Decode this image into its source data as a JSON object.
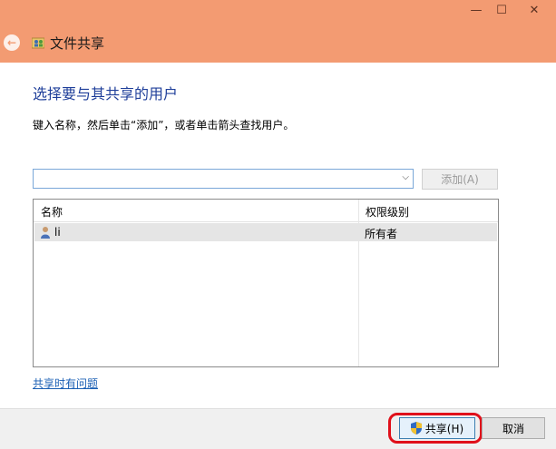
{
  "window": {
    "title": "文件共享",
    "minimize_glyph": "—",
    "maximize_glyph": "☐",
    "close_glyph": "✕"
  },
  "content": {
    "heading": "选择要与其共享的用户",
    "instruction": "键入名称，然后单击“添加”，或者单击箭头查找用户。",
    "combo_value": "",
    "add_button": "添加(A)",
    "help_link": "共享时有问题"
  },
  "table": {
    "columns": [
      "名称",
      "权限级别"
    ],
    "rows": [
      {
        "name": "li",
        "permission": "所有者"
      }
    ]
  },
  "footer": {
    "share_button": "共享(H)",
    "cancel_button": "取消"
  },
  "colors": {
    "titlebar": "#f39b72",
    "heading": "#1f3f9a",
    "link": "#1a5fb4",
    "highlight": "#e0101a"
  },
  "icons": [
    "back-arrow-icon",
    "file-share-icon",
    "user-icon",
    "uac-shield-icon",
    "chevron-down-icon"
  ]
}
